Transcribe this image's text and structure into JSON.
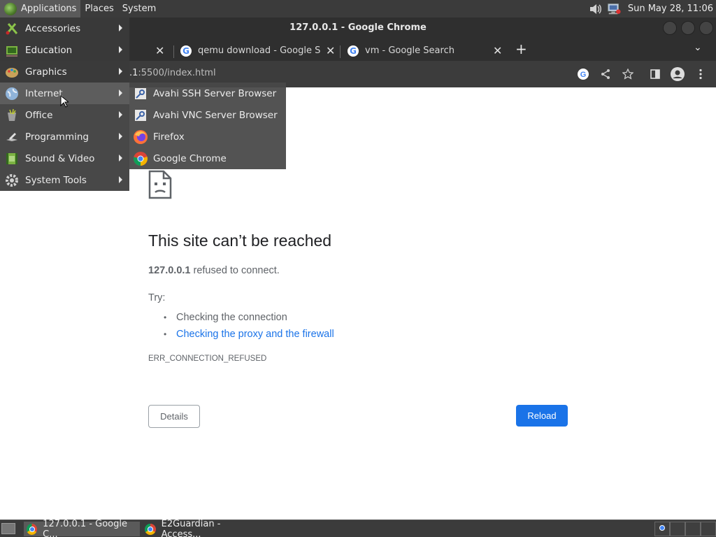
{
  "top_panel": {
    "menus": [
      "Applications",
      "Places",
      "System"
    ],
    "clock": "Sun May 28, 11:06",
    "tray_icons": [
      "volume-icon",
      "network-icon"
    ]
  },
  "window": {
    "title": "127.0.0.1 - Google Chrome"
  },
  "tabs": [
    {
      "title": "",
      "close": "✕"
    },
    {
      "title": "qemu download - Google Search",
      "close": "✕",
      "favicon": "G"
    },
    {
      "title": "vm - Google Search",
      "close": "✕",
      "favicon": "G"
    }
  ],
  "new_tab": "+",
  "tab_list": "⌄",
  "omnibox": {
    "url_visible_prefix": ".1",
    "url_visible_rest": ":5500/index.html"
  },
  "toolbar_icons": [
    "google-lens-icon",
    "share-icon",
    "bookmark-star-icon",
    "side-panel-icon",
    "profile-icon",
    "kebab-menu-icon"
  ],
  "error_page": {
    "heading": "This site can’t be reached",
    "host": "127.0.0.1",
    "detail_rest": " refused to connect.",
    "try_label": "Try:",
    "suggestions": [
      {
        "text": "Checking the connection",
        "link": false
      },
      {
        "text": "Checking the proxy and the firewall",
        "link": true
      }
    ],
    "error_code": "ERR_CONNECTION_REFUSED",
    "details_button": "Details",
    "reload_button": "Reload"
  },
  "apps_menu": {
    "items": [
      {
        "label": "Accessories",
        "icon": "accessories-icon"
      },
      {
        "label": "Education",
        "icon": "education-icon"
      },
      {
        "label": "Graphics",
        "icon": "graphics-icon"
      },
      {
        "label": "Internet",
        "icon": "internet-globe-icon",
        "hover": true
      },
      {
        "label": "Office",
        "icon": "office-icon"
      },
      {
        "label": "Programming",
        "icon": "programming-icon"
      },
      {
        "label": "Sound & Video",
        "icon": "sound-video-icon"
      },
      {
        "label": "System Tools",
        "icon": "system-tools-icon"
      }
    ]
  },
  "internet_submenu": {
    "items": [
      {
        "label": "Avahi SSH Server Browser",
        "icon": "avahi-ssh-icon"
      },
      {
        "label": "Avahi VNC Server Browser",
        "icon": "avahi-vnc-icon"
      },
      {
        "label": "Firefox",
        "icon": "firefox-icon"
      },
      {
        "label": "Google Chrome",
        "icon": "chrome-icon"
      }
    ]
  },
  "taskbar": {
    "tasks": [
      {
        "label": "127.0.0.1 - Google C...",
        "active": true
      },
      {
        "label": "E2Guardian - Access...",
        "active": false
      }
    ]
  },
  "colors": {
    "panel": "#3b3b3b",
    "chrome_frame": "#2f2f2f",
    "link": "#1a73e8",
    "reload_button": "#1a73e8"
  }
}
